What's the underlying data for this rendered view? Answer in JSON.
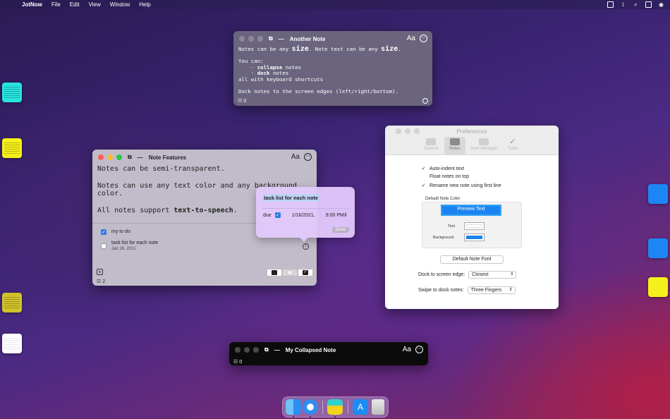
{
  "menubar": {
    "apple_glyph": "",
    "items": [
      "JotNow",
      "File",
      "Edit",
      "View",
      "Window",
      "Help"
    ],
    "status_icons": [
      "note-icon",
      "antenna-icon",
      "search-icon",
      "control-center-icon",
      "siri-icon"
    ]
  },
  "another_note": {
    "title": "Another Note",
    "aa": "Aa",
    "more": "···",
    "line1_a": "Notes can be any ",
    "line1_big1": "size",
    "line1_b": ". Note text can be any ",
    "line1_big2": "size",
    "line1_c": ".",
    "you_can": "You can:",
    "bullet1_dash": "    - ",
    "bullet1_bold": "collapse",
    "bullet1_rest": " notes",
    "bullet2_dash": "    - ",
    "bullet2_bold": "dock",
    "bullet2_rest": " notes",
    "line_shortcuts": "all with keyboard shortcuts",
    "line_dock": "Dock notes to the screen edges (left/right/bottom).",
    "task_count": "0"
  },
  "note_features": {
    "title": "Note Features",
    "aa": "Aa",
    "more": "···",
    "line1": "Notes can be semi-transparent.",
    "line2": "Notes can use any text color and any background",
    "line3": "color.",
    "line4_a": "All notes support ",
    "line4_b": "text-to-speech",
    "line4_c": ".",
    "tasks": [
      {
        "label": "my to do",
        "checked": true,
        "date": ""
      },
      {
        "label": "task list for each note",
        "checked": false,
        "date": "Jan 16, 2021"
      }
    ],
    "add": "+",
    "task_count": "2"
  },
  "popover": {
    "title": "task list for each note",
    "due_label": "due",
    "date": "1/16/2021,",
    "time": "9:00 PM",
    "done": "Done"
  },
  "preferences": {
    "title": "Preferences",
    "tabs": [
      {
        "label": "General",
        "active": false
      },
      {
        "label": "Notes",
        "active": true
      },
      {
        "label": "Note Manager",
        "active": false
      },
      {
        "label": "Tasks",
        "active": false
      }
    ],
    "checks": [
      {
        "label": "Auto-indent text",
        "checked": true
      },
      {
        "label": "Float notes on top",
        "checked": false
      },
      {
        "label": "Rename new note using first line",
        "checked": true
      }
    ],
    "default_color_label": "Default Note Color",
    "preview_text": "Preview Text",
    "text_label": "Text",
    "background_label": "Background",
    "text_color": "#ffffff",
    "background_color": "#1c84f1",
    "font_button": "Default Note Font",
    "dock_edge_label": "Dock to screen edge:",
    "dock_edge_value": "Closest",
    "swipe_label": "Swipe to dock notes:",
    "swipe_value": "Three Fingers"
  },
  "collapsed_note": {
    "title": "My Collapsed Note",
    "aa": "Aa",
    "more": "···",
    "task_count": "0"
  },
  "docked_notes": [
    {
      "side": "left",
      "color": "#27e3de"
    },
    {
      "side": "left",
      "color": "#f6f01a"
    },
    {
      "side": "left",
      "color": "#d2c22a"
    },
    {
      "side": "left",
      "color": "#ffffff"
    },
    {
      "side": "right",
      "color": "#1e86f4"
    },
    {
      "side": "right",
      "color": "#1e86f4"
    },
    {
      "side": "right",
      "color": "#f6f01a"
    }
  ],
  "dock": {
    "apps": [
      "finder-icon",
      "safari-icon",
      "jotnow-icon",
      "app-store-icon",
      "trash-icon"
    ]
  },
  "colors": {
    "accent": "#2a7be4",
    "traffic_red": "#ff5f57",
    "traffic_yellow": "#febc2e",
    "traffic_green": "#28c840"
  }
}
